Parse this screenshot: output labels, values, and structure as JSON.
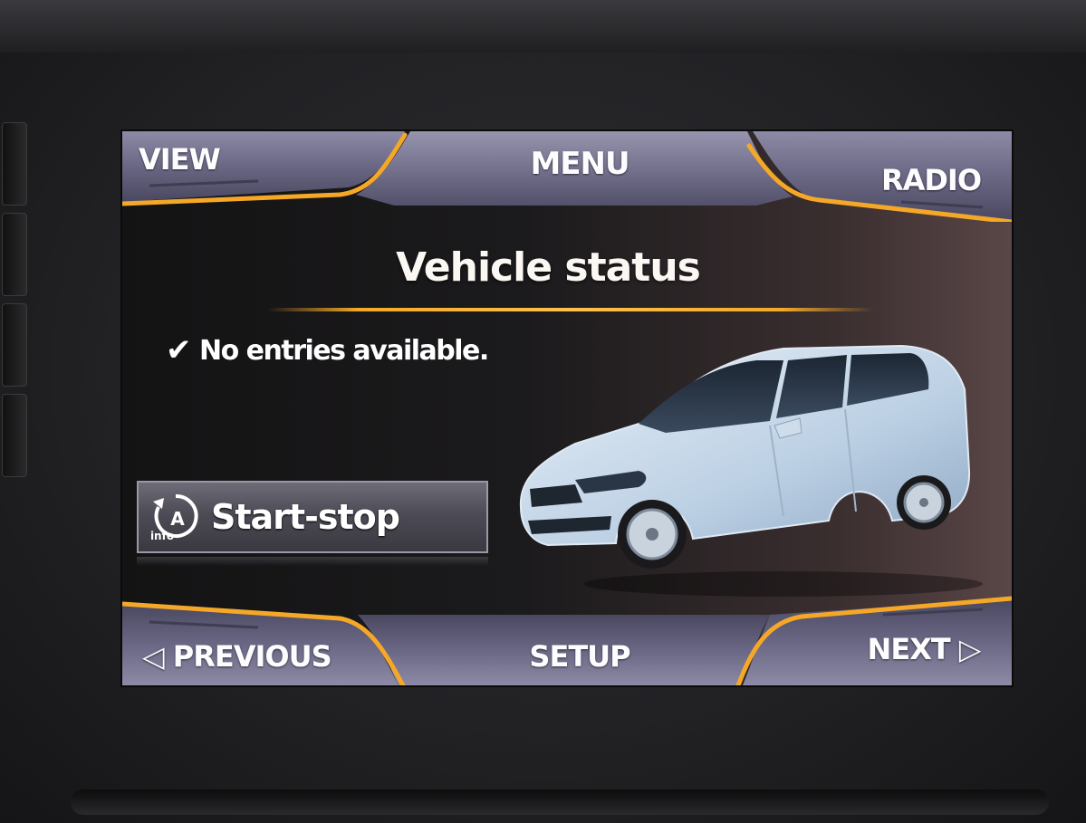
{
  "screen": {
    "top_bar": {
      "left_label": "VIEW",
      "center_label": "MENU",
      "right_label": "RADIO"
    },
    "title": "Vehicle status",
    "status": {
      "icon": "checkmark-icon",
      "text": "No entries available."
    },
    "start_stop_button": {
      "icon": "start-stop-info-icon",
      "icon_text": "info",
      "icon_letter": "A",
      "label": "Start-stop"
    },
    "bottom_bar": {
      "left_label": "◁ PREVIOUS",
      "center_label": "SETUP",
      "right_label": "NEXT ▷"
    },
    "illustration": "car-image"
  },
  "colors": {
    "accent": "#f5a828",
    "tab_fill": "#6e6b86",
    "screen_bg": "#1b1a1c",
    "text": "#ffffff"
  }
}
